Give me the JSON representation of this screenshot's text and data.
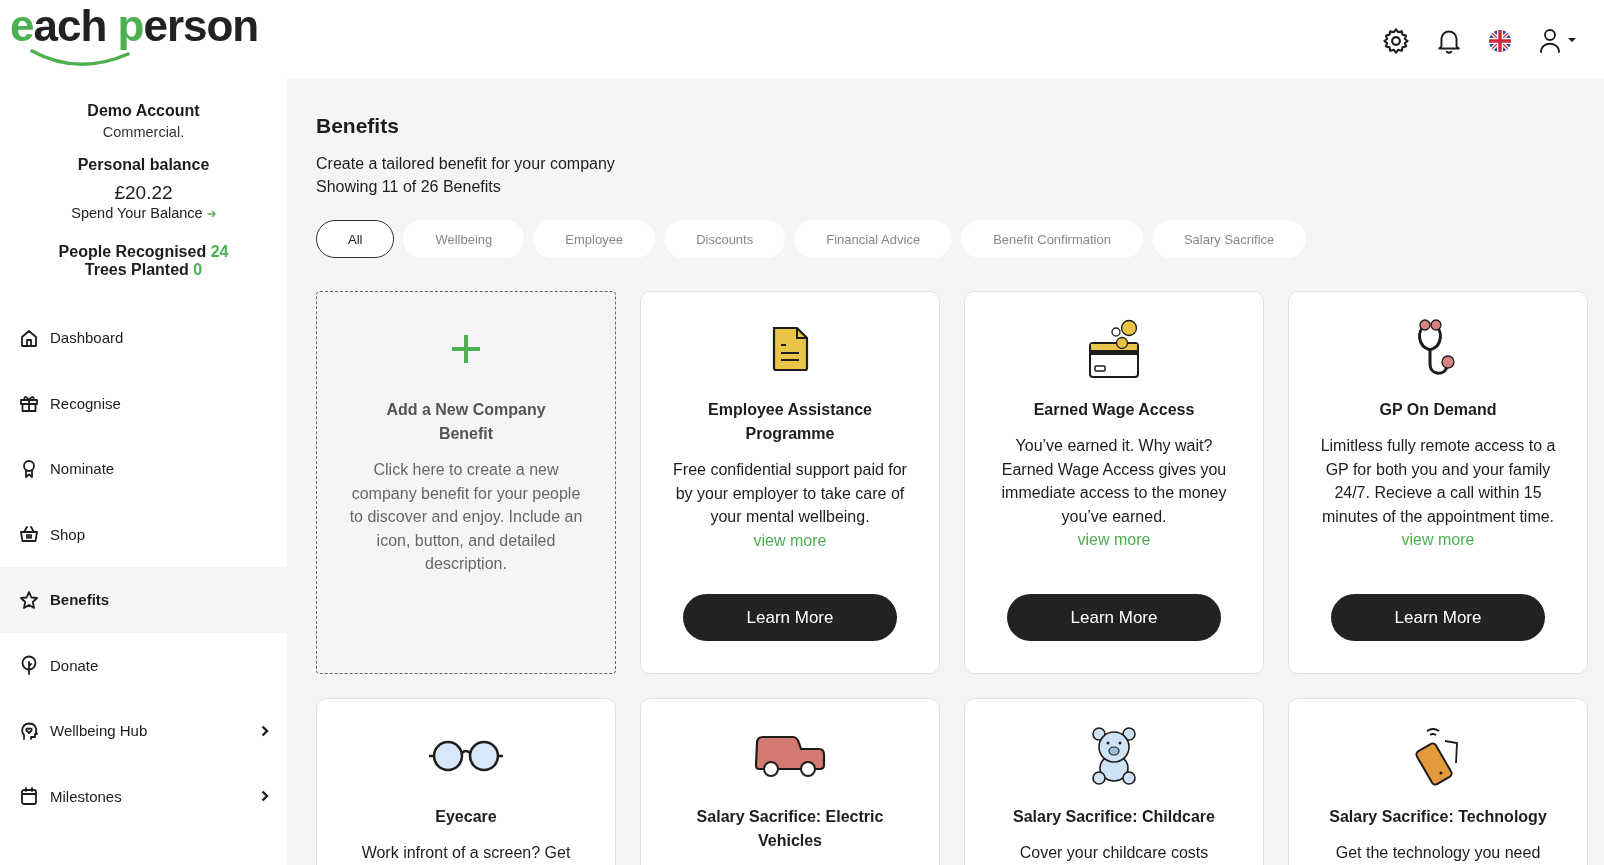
{
  "logo": {
    "parts": [
      {
        "text": "e",
        "accent": true
      },
      {
        "text": "ach ",
        "accent": false
      },
      {
        "text": "p",
        "accent": true
      },
      {
        "text": "erson",
        "accent": false
      }
    ]
  },
  "account": {
    "name": "Demo Account",
    "type": "Commercial.",
    "balance_label": "Personal balance",
    "balance": "£20.22",
    "spend_link": "Spend Your Balance",
    "stats": [
      {
        "label": "People Recognised",
        "value": "24"
      },
      {
        "label": "Trees Planted",
        "value": "0"
      }
    ]
  },
  "sidebar": {
    "items": [
      {
        "label": "Dashboard",
        "selected": false,
        "submenu": false
      },
      {
        "label": "Recognise",
        "selected": false,
        "submenu": false
      },
      {
        "label": "Nominate",
        "selected": false,
        "submenu": false
      },
      {
        "label": "Shop",
        "selected": false,
        "submenu": false
      },
      {
        "label": "Benefits",
        "selected": true,
        "submenu": false
      },
      {
        "label": "Donate",
        "selected": false,
        "submenu": false
      },
      {
        "label": "Wellbeing Hub",
        "selected": false,
        "submenu": true
      },
      {
        "label": "Milestones",
        "selected": false,
        "submenu": true
      }
    ]
  },
  "page": {
    "title": "Benefits",
    "subtitle": "Create a tailored benefit for your company",
    "count": "Showing 11 of 26 Benefits"
  },
  "filters": [
    {
      "label": "All",
      "selected": true
    },
    {
      "label": "Wellbeing",
      "selected": false
    },
    {
      "label": "Employee",
      "selected": false
    },
    {
      "label": "Discounts",
      "selected": false
    },
    {
      "label": "Financial Advice",
      "selected": false
    },
    {
      "label": "Benefit Confirmation",
      "selected": false
    },
    {
      "label": "Salary Sacrifice",
      "selected": false
    }
  ],
  "cards": [
    {
      "kind": "add",
      "title": "Add a New Company Benefit",
      "description": "Click here to create a new company benefit for your people to discover and enjoy. Include an icon, button, and detailed description."
    },
    {
      "kind": "benefit",
      "title": "Employee Assistance Programme",
      "description": "Free confidential support paid for by your employer to take care of your mental wellbeing.",
      "link": "view more",
      "button": "Learn More"
    },
    {
      "kind": "benefit",
      "title": "Earned Wage Access",
      "description": "You’ve earned it. Why wait? Earned Wage Access gives you immediate access to the money you’ve earned.",
      "link": "view more",
      "button": "Learn More"
    },
    {
      "kind": "benefit",
      "title": "GP On Demand",
      "description": "Limitless fully remote access to a GP for both you and your family 24/7. Recieve a call within 15 minutes of the appointment time.",
      "link": "view more",
      "button": "Learn More"
    },
    {
      "kind": "benefit",
      "title": "Eyecare",
      "description": "Work infront of a screen? Get"
    },
    {
      "kind": "benefit",
      "title": "Salary Sacrifice: Electric Vehicles"
    },
    {
      "kind": "benefit",
      "title": "Salary Sacrifice: Childcare",
      "description": "Cover your childcare costs"
    },
    {
      "kind": "benefit",
      "title": "Salary Sacrifice: Technology",
      "description": "Get the technology you need"
    }
  ]
}
